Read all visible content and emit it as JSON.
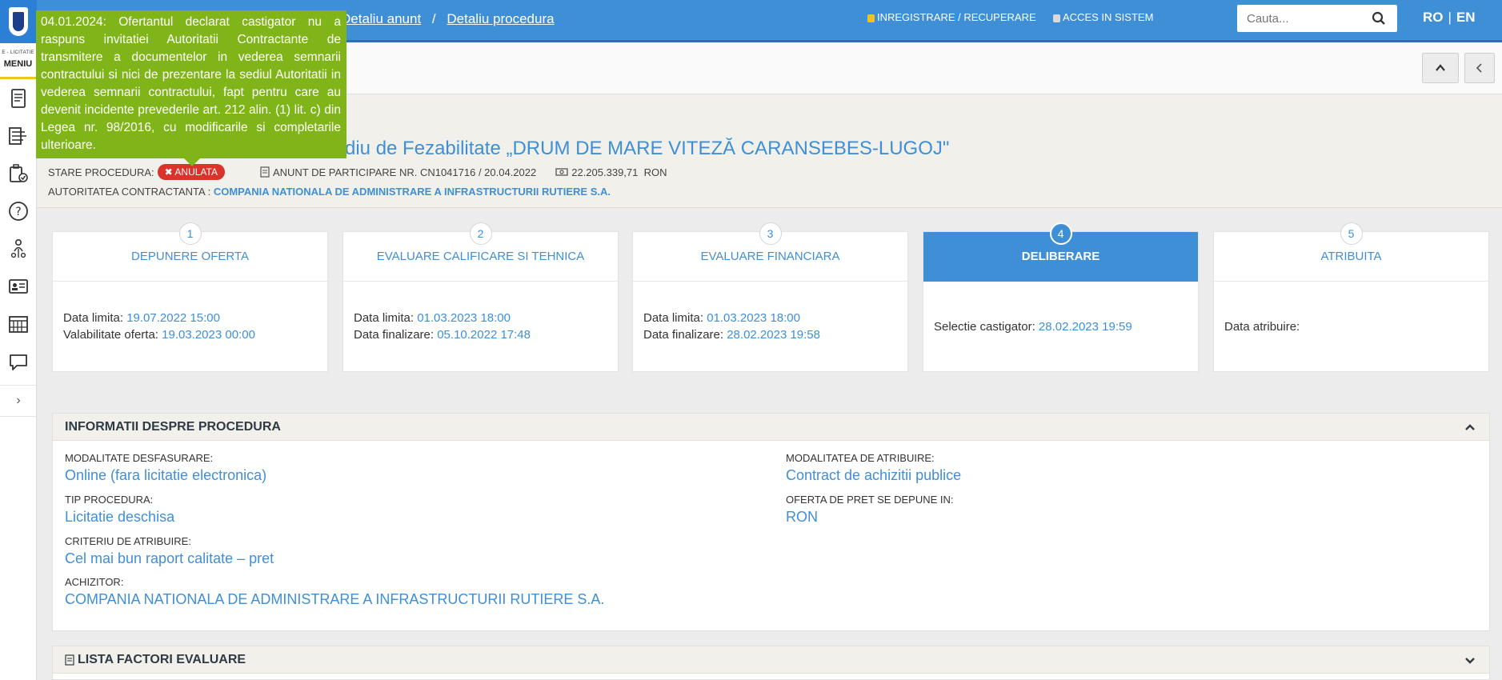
{
  "rail": {
    "subtitle": "E - LICITATIE",
    "menu_label": "MENIU",
    "icons": [
      "document-list-icon",
      "form-list-icon",
      "checklist-icon",
      "help-icon",
      "user-hierarchy-icon",
      "id-card-icon",
      "building-icon",
      "chat-bubble-icon"
    ],
    "expand_icon": "chevron-right-icon"
  },
  "header": {
    "breadcrumbs": [
      "Detaliu anunt",
      "Detaliu procedura"
    ],
    "breadcrumb_sep": "/",
    "register_label": "INREGISTRARE / RECUPERARE",
    "login_label": "ACCES IN SISTEM",
    "search_placeholder": "Cauta...",
    "lang_ro": "RO",
    "lang_sep": "|",
    "lang_en": "EN"
  },
  "toolbar": {
    "scroll_top_icon": "chevron-up-icon",
    "back_icon": "chevron-left-icon"
  },
  "procedure": {
    "title_visible": "diu de Fezabilitate „DRUM DE MARE VITEZĂ CARANSEBES-LUGOJ\"",
    "status_label": "STARE PROCEDURA:",
    "status_badge": "ANULATA",
    "notice": "ANUNT DE PARTICIPARE NR. CN1041716 / 20.04.2022",
    "value": "22.205.339,71",
    "currency": "RON",
    "authority_label": "AUTORITATEA CONTRACTANTA :",
    "authority": "COMPANIA NATIONALA DE ADMINISTRARE A INFRASTRUCTURII RUTIERE S.A."
  },
  "tooltip": {
    "text": "04.01.2024: Ofertantul declarat castigator nu a raspuns invitatiei Autoritatii Contractante de transmitere a documentelor in vederea semnarii contractului si nici de prezentare la sediul Autoritatii in vederea semnarii contractului, fapt pentru care au devenit incidente prevederile art. 212 alin. (1) lit. c) din Legea nr. 98/2016, cu modificarile si completarile ulterioare."
  },
  "steps": [
    {
      "num": "1",
      "title": "DEPUNERE OFERTA",
      "l1": "Data limita: ",
      "v1": "19.07.2022 15:00",
      "l2": "Valabilitate oferta: ",
      "v2": "19.03.2023 00:00"
    },
    {
      "num": "2",
      "title": "EVALUARE CALIFICARE SI TEHNICA",
      "l1": "Data limita: ",
      "v1": "01.03.2023 18:00",
      "l2": "Data finalizare: ",
      "v2": "05.10.2022 17:48"
    },
    {
      "num": "3",
      "title": "EVALUARE FINANCIARA",
      "l1": "Data limita: ",
      "v1": "01.03.2023 18:00",
      "l2": "Data finalizare: ",
      "v2": "28.02.2023 19:58"
    },
    {
      "num": "4",
      "title": "DELIBERARE",
      "l1": "Selectie castigator: ",
      "v1": "28.02.2023 19:59"
    },
    {
      "num": "5",
      "title": "ATRIBUITA",
      "l1": "Data atribuire:"
    }
  ],
  "info_panel": {
    "title": "INFORMATII DESPRE PROCEDURA",
    "fields": {
      "modalitate_label": "MODALITATE DESFASURARE:",
      "modalitate_value": "Online (fara licitatie electronica)",
      "tip_label": "TIP PROCEDURA:",
      "tip_value": "Licitatie deschisa",
      "criteriu_label": "CRITERIU DE ATRIBUIRE:",
      "criteriu_value": "Cel mai bun raport calitate – pret",
      "achizitor_label": "ACHIZITOR:",
      "achizitor_value": "COMPANIA NATIONALA DE ADMINISTRARE A INFRASTRUCTURII RUTIERE S.A.",
      "atribuire_label": "MODALITATEA DE ATRIBUIRE:",
      "atribuire_value": "Contract de achizitii publice",
      "oferta_label": "OFERTA DE PRET SE DEPUNE IN:",
      "oferta_value": "RON"
    }
  },
  "factors_panel": {
    "title": "LISTA FACTORI EVALUARE"
  },
  "colors": {
    "accent": "#3f8fd6",
    "tooltip": "#7fb518",
    "status": "#d9332c"
  }
}
